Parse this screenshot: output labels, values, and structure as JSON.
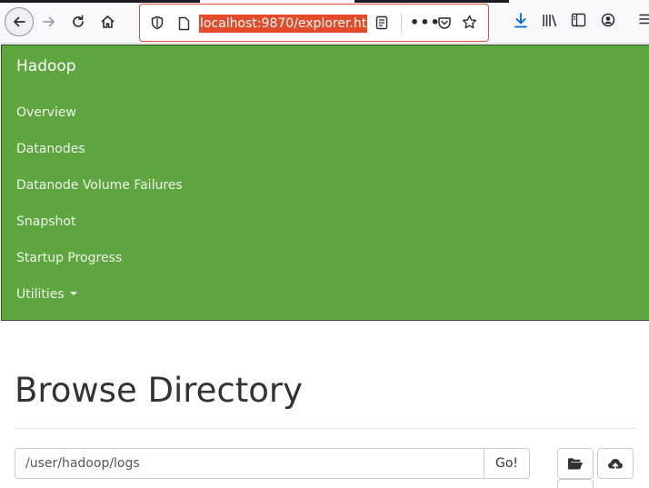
{
  "browser": {
    "url": "localhost:9870/explorer.ht",
    "icons": [
      "back-arrow-icon",
      "forward-arrow-icon",
      "reload-icon",
      "home-icon",
      "tracking-shield-icon",
      "page-icon",
      "reader-view-icon",
      "more-icon",
      "pocket-icon",
      "bookmark-star-icon",
      "download-icon",
      "library-icon",
      "sidebar-icon",
      "account-icon",
      "menu-icon"
    ]
  },
  "navbar": {
    "brand": "Hadoop",
    "links": [
      "Overview",
      "Datanodes",
      "Datanode Volume Failures",
      "Snapshot",
      "Startup Progress",
      "Utilities"
    ],
    "color": "#5fa640"
  },
  "main": {
    "title": "Browse Directory",
    "path_value": "/user/hadoop/logs",
    "go_label": "Go!",
    "icons": [
      "folder-open-icon",
      "cloud-upload-icon"
    ]
  }
}
